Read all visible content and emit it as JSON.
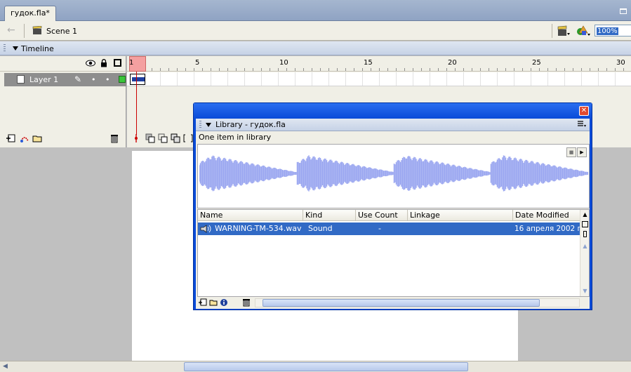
{
  "document": {
    "tab_title": "гудок.fla*"
  },
  "editbar": {
    "scene_label": "Scene 1",
    "zoom": "100%"
  },
  "timeline": {
    "title": "Timeline",
    "ruler_numbers": [
      "1",
      "5",
      "10",
      "15",
      "20",
      "25",
      "30"
    ],
    "layer": {
      "name": "Layer 1",
      "color": "#3ac63a"
    }
  },
  "library": {
    "title": "Library - гудок.fla",
    "count_text": "One item in library",
    "columns": {
      "name": "Name",
      "kind": "Kind",
      "use_count": "Use Count",
      "linkage": "Linkage",
      "date_modified": "Date Modified"
    },
    "items": [
      {
        "name": "WARNING-TM-534.wav",
        "kind": "Sound",
        "use_count": "-",
        "linkage": "",
        "date_modified": "16 апреля 2002 г."
      }
    ],
    "waveform_color": "#9aa6f0",
    "selection_color": "#316ac5"
  }
}
